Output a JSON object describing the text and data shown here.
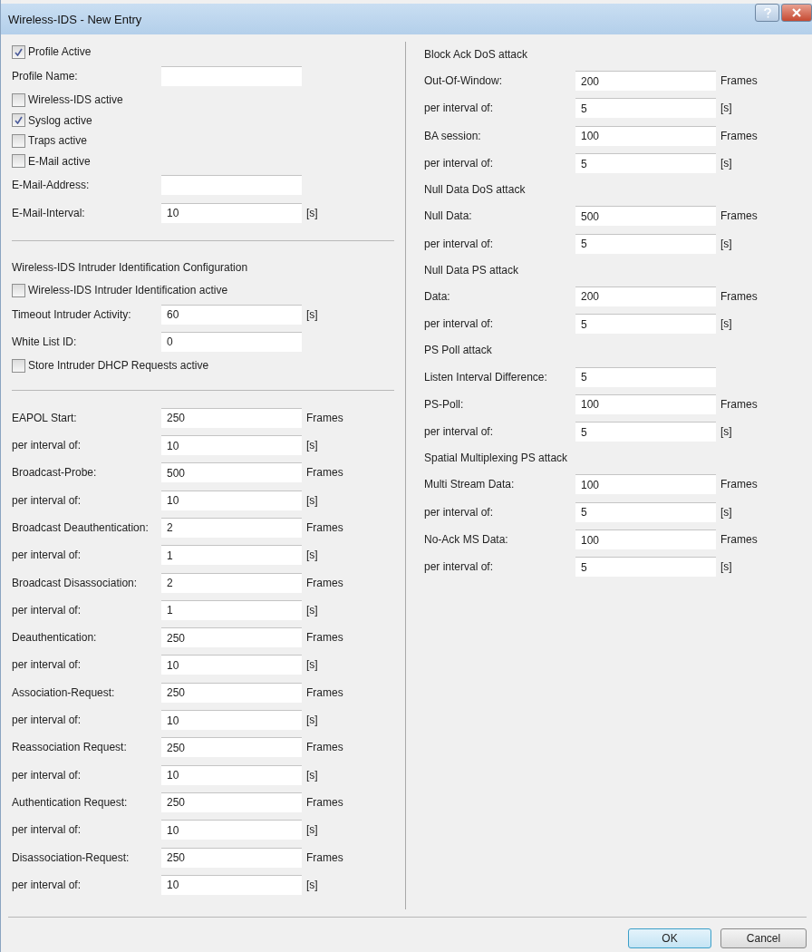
{
  "window": {
    "title": "Wireless-IDS - New Entry"
  },
  "left": [
    {
      "kind": "checkbox",
      "label": "Profile Active",
      "checked": true
    },
    {
      "kind": "field",
      "label": "Profile Name:"
    },
    {
      "kind": "checkbox",
      "label": "Wireless-IDS active",
      "checked": false
    },
    {
      "kind": "checkbox",
      "label": "Syslog active",
      "checked": true
    },
    {
      "kind": "checkbox",
      "label": "Traps active",
      "checked": false
    },
    {
      "kind": "checkbox",
      "label": "E-Mail active",
      "checked": false
    },
    {
      "kind": "field",
      "label": "E-Mail-Address:"
    },
    {
      "kind": "field",
      "label": "E-Mail-Interval:",
      "value": "10",
      "unit": "[s]"
    },
    {
      "kind": "separator"
    },
    {
      "kind": "heading",
      "label": "Wireless-IDS Intruder Identification Configuration"
    },
    {
      "kind": "checkbox",
      "label": "Wireless-IDS Intruder Identification active",
      "checked": false
    },
    {
      "kind": "field",
      "label": "Timeout Intruder Activity:",
      "value": "60",
      "unit": "[s]"
    },
    {
      "kind": "field",
      "label": "White List ID:",
      "value": "0"
    },
    {
      "kind": "checkbox",
      "label": "Store Intruder DHCP Requests active",
      "checked": false
    },
    {
      "kind": "separator"
    },
    {
      "kind": "field",
      "label": "EAPOL Start:",
      "value": "250",
      "unit": "Frames"
    },
    {
      "kind": "field",
      "label": "per interval of:",
      "value": "10",
      "unit": "[s]"
    },
    {
      "kind": "field",
      "label": "Broadcast-Probe:",
      "value": "500",
      "unit": "Frames"
    },
    {
      "kind": "field",
      "label": "per interval of:",
      "value": "10",
      "unit": "[s]"
    },
    {
      "kind": "field",
      "label": "Broadcast Deauthentication:",
      "value": "2",
      "unit": "Frames"
    },
    {
      "kind": "field",
      "label": "per interval of:",
      "value": "1",
      "unit": "[s]"
    },
    {
      "kind": "field",
      "label": "Broadcast Disassociation:",
      "value": "2",
      "unit": "Frames"
    },
    {
      "kind": "field",
      "label": "per interval of:",
      "value": "1",
      "unit": "[s]"
    },
    {
      "kind": "field",
      "label": "Deauthentication:",
      "value": "250",
      "unit": "Frames"
    },
    {
      "kind": "field",
      "label": "per interval of:",
      "value": "10",
      "unit": "[s]"
    },
    {
      "kind": "field",
      "label": "Association-Request:",
      "value": "250",
      "unit": "Frames"
    },
    {
      "kind": "field",
      "label": "per interval of:",
      "value": "10",
      "unit": "[s]"
    },
    {
      "kind": "field",
      "label": "Reassociation Request:",
      "value": "250",
      "unit": "Frames"
    },
    {
      "kind": "field",
      "label": "per interval of:",
      "value": "10",
      "unit": "[s]"
    },
    {
      "kind": "field",
      "label": "Authentication Request:",
      "value": "250",
      "unit": "Frames"
    },
    {
      "kind": "field",
      "label": "per interval of:",
      "value": "10",
      "unit": "[s]"
    },
    {
      "kind": "field",
      "label": "Disassociation-Request:",
      "value": "250",
      "unit": "Frames"
    },
    {
      "kind": "field",
      "label": "per interval of:",
      "value": "10",
      "unit": "[s]"
    }
  ],
  "right": [
    {
      "kind": "heading",
      "label": "Block Ack DoS attack"
    },
    {
      "kind": "field",
      "label": "Out-Of-Window:",
      "value": "200",
      "unit": "Frames"
    },
    {
      "kind": "field",
      "label": "per interval of:",
      "value": "5",
      "unit": "[s]"
    },
    {
      "kind": "field",
      "label": "BA session:",
      "value": "100",
      "unit": "Frames"
    },
    {
      "kind": "field",
      "label": "per interval of:",
      "value": "5",
      "unit": "[s]"
    },
    {
      "kind": "heading",
      "label": "Null Data DoS attack"
    },
    {
      "kind": "field",
      "label": "Null Data:",
      "value": "500",
      "unit": "Frames"
    },
    {
      "kind": "field",
      "label": "per interval of:",
      "value": "5",
      "unit": "[s]"
    },
    {
      "kind": "heading",
      "label": "Null Data PS attack"
    },
    {
      "kind": "field",
      "label": "Data:",
      "value": "200",
      "unit": "Frames"
    },
    {
      "kind": "field",
      "label": "per interval of:",
      "value": "5",
      "unit": "[s]"
    },
    {
      "kind": "heading",
      "label": "PS Poll attack"
    },
    {
      "kind": "field",
      "label": "Listen Interval Difference:",
      "value": "5"
    },
    {
      "kind": "field",
      "label": "PS-Poll:",
      "value": "100",
      "unit": "Frames"
    },
    {
      "kind": "field",
      "label": "per interval of:",
      "value": "5",
      "unit": "[s]"
    },
    {
      "kind": "heading",
      "label": "Spatial Multiplexing PS attack"
    },
    {
      "kind": "field",
      "label": "Multi Stream Data:",
      "value": "100",
      "unit": "Frames"
    },
    {
      "kind": "field",
      "label": "per interval of:",
      "value": "5",
      "unit": "[s]"
    },
    {
      "kind": "field",
      "label": "No-Ack MS Data:",
      "value": "100",
      "unit": "Frames"
    },
    {
      "kind": "field",
      "label": "per interval of:",
      "value": "5",
      "unit": "[s]"
    }
  ],
  "buttons": [
    {
      "label": "OK",
      "default": true
    },
    {
      "label": "Cancel",
      "default": false
    }
  ]
}
